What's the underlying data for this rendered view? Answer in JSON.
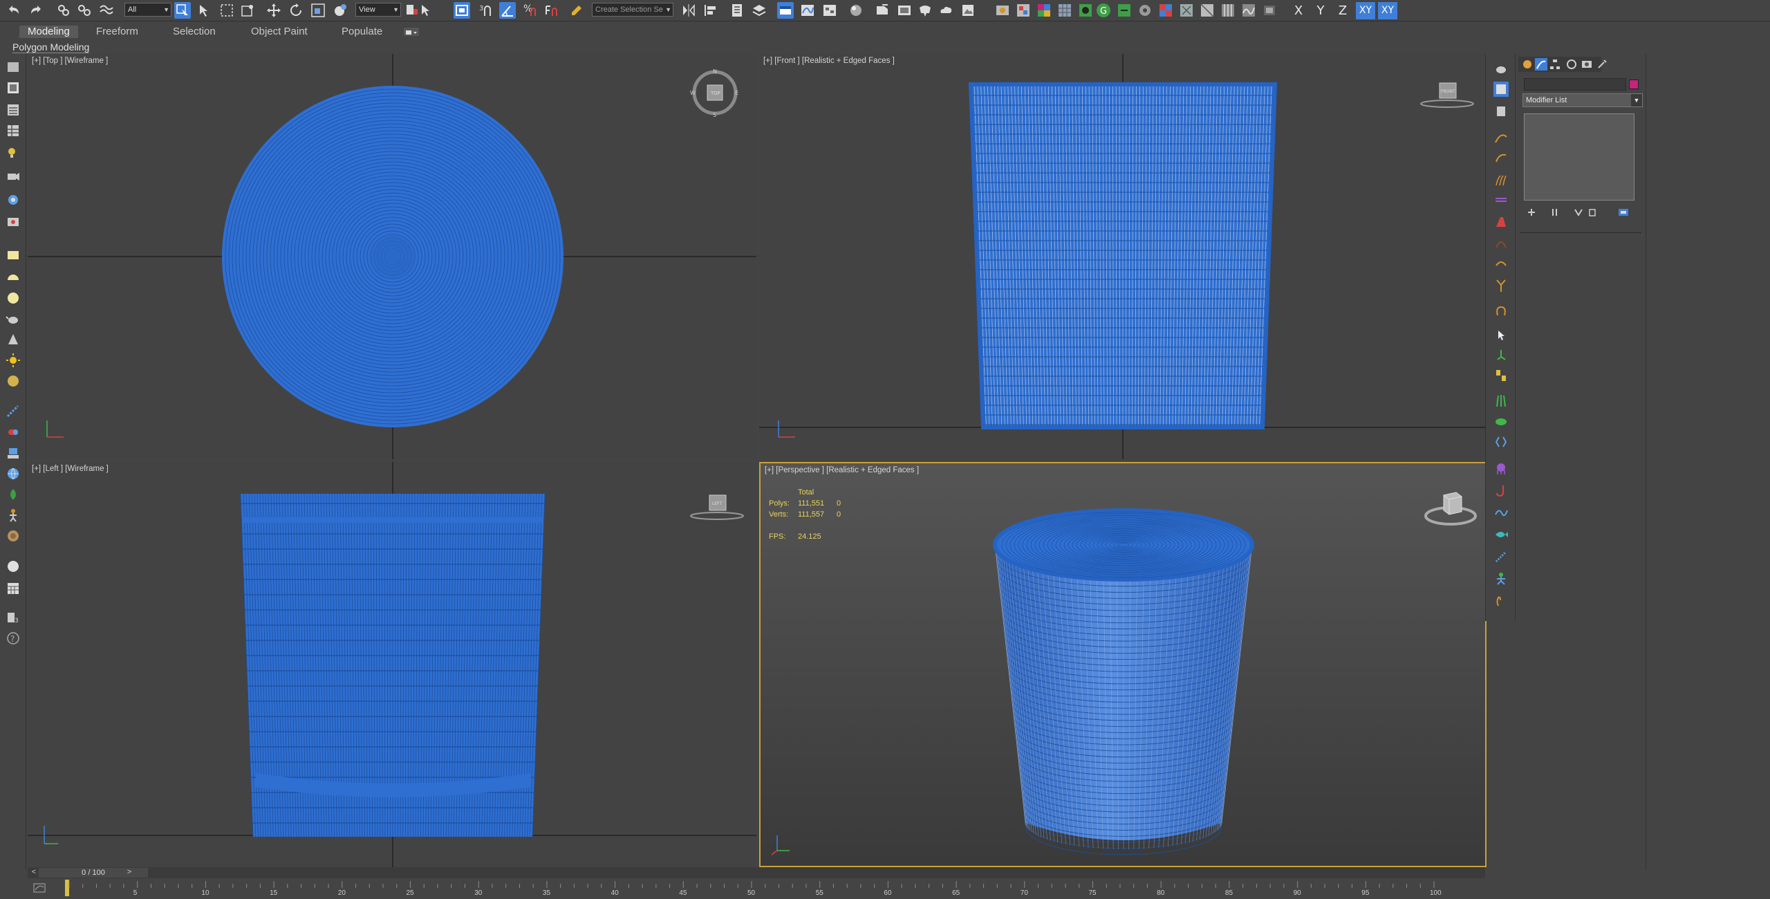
{
  "toolbar": {
    "selection_filter": "All",
    "reference_coord": "View",
    "named_selection_placeholder": "Create Selection Se",
    "axis_buttons": [
      "X",
      "Y",
      "Z",
      "XY",
      "XY"
    ],
    "snap_label": "3",
    "percent_snap_icon": "percent-snap-icon"
  },
  "ribbon": {
    "tabs": [
      "Modeling",
      "Freeform",
      "Selection",
      "Object Paint",
      "Populate"
    ],
    "active_tab": "Modeling",
    "sub_label": "Polygon Modeling"
  },
  "viewports": {
    "top": {
      "label": "[+] [Top ] [Wireframe ]",
      "viewcube_face": "TOP",
      "compass": [
        "N",
        "E",
        "S",
        "W"
      ]
    },
    "front": {
      "label": "[+] [Front ] [Realistic + Edged Faces ]",
      "viewcube_face": "FRONT"
    },
    "left": {
      "label": "[+] [Left ] [Wireframe ]",
      "viewcube_face": "LEFT"
    },
    "perspective": {
      "label": "[+] [Perspective ] [Realistic + Edged Faces ]",
      "stats": {
        "total_label": "Total",
        "polys_label": "Polys:",
        "polys_total": "111,551",
        "polys_sel": "0",
        "verts_label": "Verts:",
        "verts_total": "111,557",
        "verts_sel": "0",
        "fps_label": "FPS:",
        "fps_value": "24.125"
      }
    }
  },
  "command_panel": {
    "modifier_list": "Modifier List",
    "name_field": "",
    "object_color": "#c8237c"
  },
  "timeline": {
    "frame_display": "0 / 100",
    "prev": "<",
    "next": ">",
    "ticks": [
      "5",
      "10",
      "15",
      "20",
      "25",
      "30",
      "35",
      "40",
      "45",
      "50",
      "55",
      "60",
      "65",
      "70",
      "75",
      "80",
      "85",
      "90",
      "95",
      "100"
    ]
  },
  "colors": {
    "mesh_blue": "#2f6fd2",
    "wire_dark": "#1c4f9e",
    "active_border": "#c9a23c",
    "stats_yellow": "#e8d45a"
  }
}
